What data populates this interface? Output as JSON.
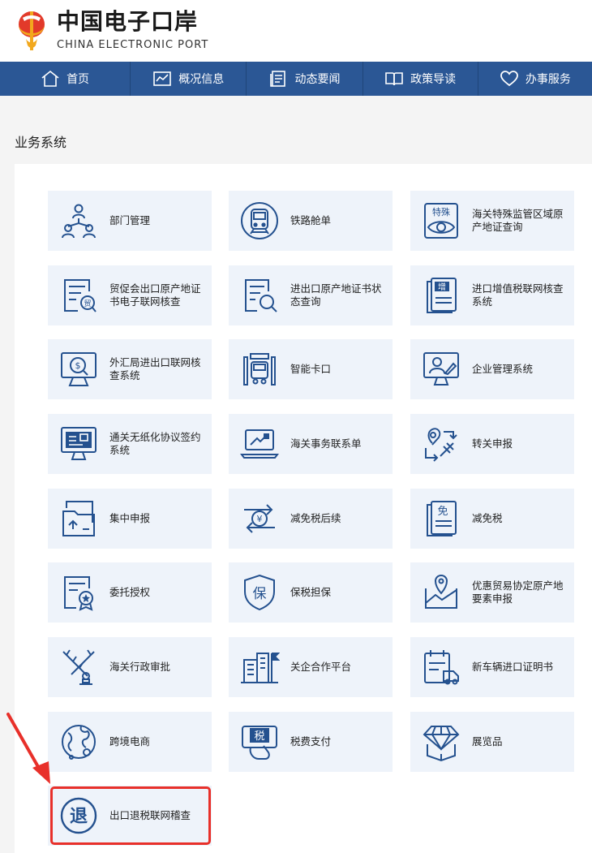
{
  "brand": {
    "cn": "中国电子口岸",
    "en": "CHINA ELECTRONIC PORT"
  },
  "nav": [
    {
      "label": "首页",
      "icon": "home-icon"
    },
    {
      "label": "概况信息",
      "icon": "chart-icon"
    },
    {
      "label": "动态要闻",
      "icon": "news-icon"
    },
    {
      "label": "政策导读",
      "icon": "book-icon"
    },
    {
      "label": "办事服务",
      "icon": "heart-icon"
    }
  ],
  "section": {
    "title": "业务系统"
  },
  "cards": [
    {
      "label": "部门管理",
      "icon": "org-chart-icon"
    },
    {
      "label": "铁路舱单",
      "icon": "train-icon"
    },
    {
      "label": "海关特殊监管区域原产地证查询",
      "icon": "special-eye-icon"
    },
    {
      "label": "贸促会出口原产地证书电子联网核查",
      "icon": "trade-certificate-icon"
    },
    {
      "label": "进出口原产地证书状态查询",
      "icon": "document-search-icon"
    },
    {
      "label": "进口增值税联网核查系统",
      "icon": "vat-document-icon"
    },
    {
      "label": "外汇局进出口联网核查系统",
      "icon": "forex-monitor-icon"
    },
    {
      "label": "智能卡口",
      "icon": "truck-gate-icon"
    },
    {
      "label": "企业管理系统",
      "icon": "user-monitor-icon"
    },
    {
      "label": "通关无纸化协议签约系统",
      "icon": "paperless-monitor-icon"
    },
    {
      "label": "海关事务联系单",
      "icon": "laptop-icon"
    },
    {
      "label": "转关申报",
      "icon": "transfer-route-icon"
    },
    {
      "label": "集中申报",
      "icon": "upload-folder-icon"
    },
    {
      "label": "减免税后续",
      "icon": "yuan-exchange-icon"
    },
    {
      "label": "减免税",
      "icon": "tax-exempt-icon"
    },
    {
      "label": "委托授权",
      "icon": "authorization-certificate-icon"
    },
    {
      "label": "保税担保",
      "icon": "bonded-shield-icon"
    },
    {
      "label": "优惠贸易协定原产地要素申报",
      "icon": "map-pin-chart-icon"
    },
    {
      "label": "海关行政审批",
      "icon": "approval-stamp-icon"
    },
    {
      "label": "关企合作平台",
      "icon": "building-flag-icon"
    },
    {
      "label": "新车辆进口证明书",
      "icon": "vehicle-calendar-icon"
    },
    {
      "label": "跨境电商",
      "icon": "globe-icon"
    },
    {
      "label": "税费支付",
      "icon": "tax-payment-icon"
    },
    {
      "label": "展览品",
      "icon": "diamond-box-icon"
    },
    {
      "label": "出口退税联网稽查",
      "icon": "tax-refund-icon"
    }
  ],
  "colors": {
    "nav_bg": "#2b5795",
    "card_bg": "#eef3fa",
    "icon": "#24518f",
    "highlight": "#e8302a"
  }
}
